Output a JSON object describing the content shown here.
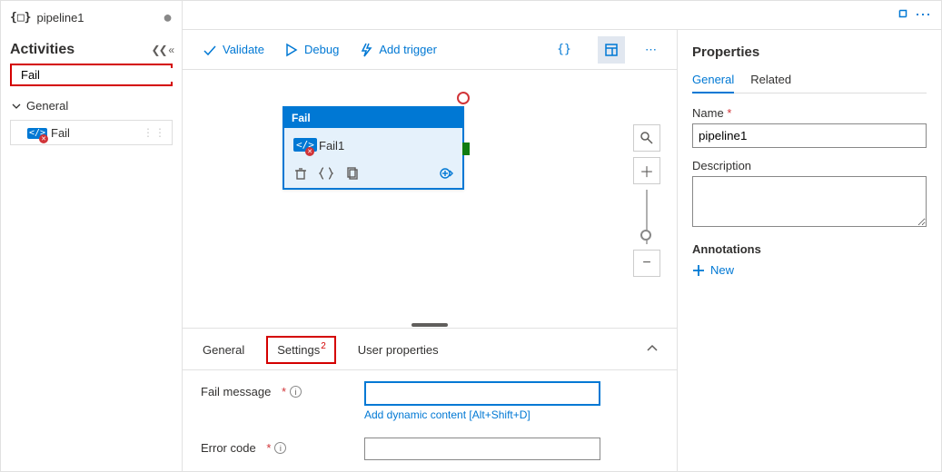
{
  "sidebar": {
    "pipeline_name": "pipeline1",
    "activities_title": "Activities",
    "search_value": "Fail",
    "category": "General",
    "activity_item": "Fail"
  },
  "toolbar": {
    "validate": "Validate",
    "debug": "Debug",
    "add_trigger": "Add trigger"
  },
  "node": {
    "type_label": "Fail",
    "name": "Fail1"
  },
  "bottom_tabs": {
    "general": "General",
    "settings": "Settings",
    "settings_badge": "2",
    "user_properties": "User properties"
  },
  "settings_form": {
    "fail_message_label": "Fail message",
    "fail_message_value": "",
    "add_dynamic": "Add dynamic content [Alt+Shift+D]",
    "error_code_label": "Error code",
    "error_code_value": ""
  },
  "properties": {
    "title": "Properties",
    "tab_general": "General",
    "tab_related": "Related",
    "name_label": "Name",
    "name_value": "pipeline1",
    "description_label": "Description",
    "description_value": "",
    "annotations_label": "Annotations",
    "new_label": "New"
  }
}
